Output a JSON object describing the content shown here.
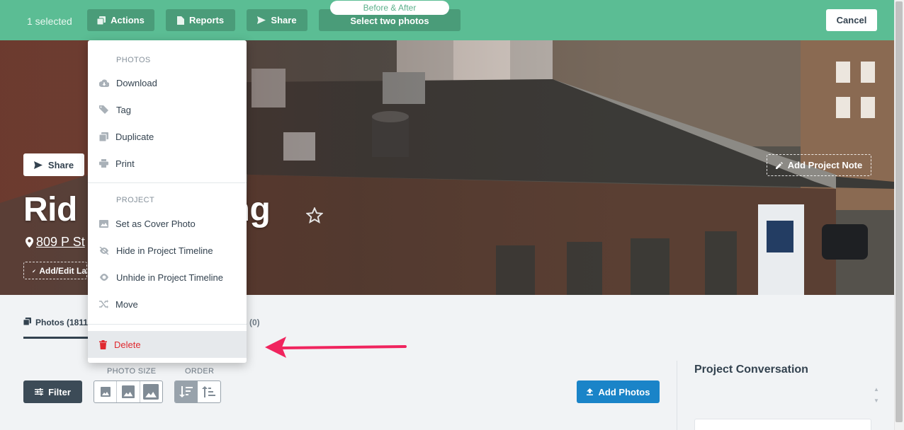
{
  "topbar": {
    "selected_text": "1 selected",
    "actions_label": "Actions",
    "reports_label": "Reports",
    "share_label": "Share",
    "before_after_label": "Before & After",
    "select_two_label": "Select two photos",
    "cancel_label": "Cancel"
  },
  "menu": {
    "photos_heading": "PHOTOS",
    "photo_items": [
      {
        "label": "Download",
        "icon": "cloud-download-icon"
      },
      {
        "label": "Tag",
        "icon": "tag-icon"
      },
      {
        "label": "Duplicate",
        "icon": "duplicate-icon"
      },
      {
        "label": "Print",
        "icon": "print-icon"
      }
    ],
    "project_heading": "PROJECT",
    "project_items": [
      {
        "label": "Set as Cover Photo",
        "icon": "image-icon"
      },
      {
        "label": "Hide in Project Timeline",
        "icon": "eye-slash-icon"
      },
      {
        "label": "Unhide in Project Timeline",
        "icon": "eye-icon"
      },
      {
        "label": "Move",
        "icon": "shuffle-icon"
      }
    ],
    "delete_label": "Delete"
  },
  "hero": {
    "share_label": "Share",
    "title_left": "Rid",
    "title_right": "ing",
    "address": "809 P St",
    "add_label_text": "Add/Edit La",
    "add_note_label": "Add Project Note"
  },
  "tabs": {
    "photos_label": "Photos (1811",
    "other_label": "ts (0)"
  },
  "controls": {
    "filter_label": "Filter",
    "photo_size_label": "PHOTO SIZE",
    "order_label": "ORDER",
    "add_photos_label": "Add Photos"
  },
  "conversation": {
    "title": "Project Conversation"
  },
  "colors": {
    "topbar": "#5bbd94",
    "topbar_button": "#4a9c79",
    "delete": "#e0292f",
    "arrow": "#f0245e",
    "primary": "#1a84c8"
  }
}
